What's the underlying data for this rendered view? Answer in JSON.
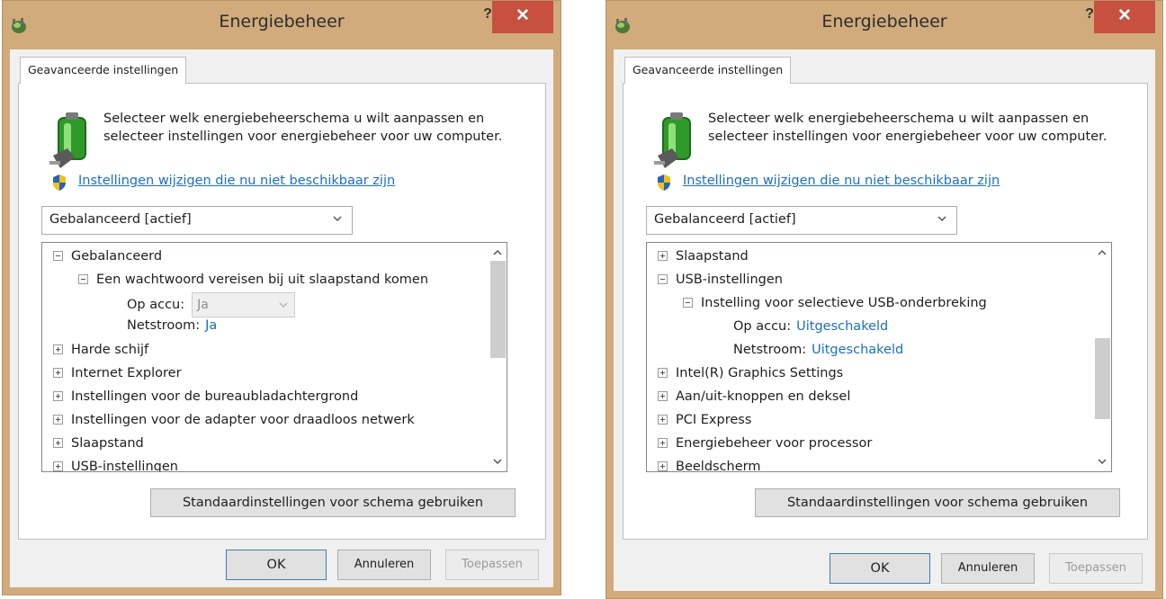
{
  "colors": {
    "frame": "#d1ab7c",
    "close_button": "#c7503f",
    "link": "#1c6ec8",
    "client": "#f0f0f0"
  },
  "dialogs": [
    {
      "title": "Energiebeheer",
      "help_label": "?",
      "close_label": "✕",
      "tab_label": "Geavanceerde instellingen",
      "description": "Selecteer welk energiebeheerschema u wilt aanpassen en selecteer instellingen voor energiebeheer voor uw computer.",
      "settings_link": "Instellingen wijzigen die nu niet beschikbaar zijn",
      "scheme_combo_value": "Gebalanceerd [actief]",
      "tree": {
        "items": [
          {
            "label": "Gebalanceerd",
            "expanded": true
          },
          {
            "label": "Een wachtwoord vereisen bij uit slaapstand komen",
            "expanded": true
          },
          {
            "label": "Op accu:",
            "value": "Ja",
            "value_kind": "disabled-combo"
          },
          {
            "label": "Netstroom:",
            "value": "Ja",
            "value_kind": "link"
          },
          {
            "label": "Harde schijf",
            "expanded": false
          },
          {
            "label": "Internet Explorer",
            "expanded": false
          },
          {
            "label": "Instellingen voor de bureaubladachtergrond",
            "expanded": false
          },
          {
            "label": "Instellingen voor de adapter voor draadloos netwerk",
            "expanded": false
          },
          {
            "label": "Slaapstand",
            "expanded": false
          },
          {
            "label": "USB-instellingen",
            "expanded": false
          }
        ],
        "scroll_position": 0.05,
        "scroll_visible_fraction": 0.54
      },
      "restore_defaults_label": "Standaardinstellingen voor schema gebruiken",
      "ok_label": "OK",
      "cancel_label": "Annuleren",
      "apply_label": "Toepassen"
    },
    {
      "title": "Energiebeheer",
      "help_label": "?",
      "close_label": "✕",
      "tab_label": "Geavanceerde instellingen",
      "description": "Selecteer welk energiebeheerschema u wilt aanpassen en selecteer instellingen voor energiebeheer voor uw computer.",
      "settings_link": "Instellingen wijzigen die nu niet beschikbaar zijn",
      "scheme_combo_value": "Gebalanceerd [actief]",
      "tree": {
        "items": [
          {
            "label": "Slaapstand",
            "expanded": false
          },
          {
            "label": "USB-instellingen",
            "expanded": true
          },
          {
            "label": "Instelling voor selectieve USB-onderbreking",
            "expanded": true
          },
          {
            "label": "Op accu:",
            "value": "Uitgeschakeld",
            "value_kind": "link"
          },
          {
            "label": "Netstroom:",
            "value": "Uitgeschakeld",
            "value_kind": "link"
          },
          {
            "label": "Intel(R) Graphics Settings",
            "expanded": false
          },
          {
            "label": "Aan/uit-knoppen en deksel",
            "expanded": false
          },
          {
            "label": "PCI Express",
            "expanded": false
          },
          {
            "label": "Energiebeheer voor processor",
            "expanded": false
          },
          {
            "label": "Beeldscherm",
            "expanded": false
          }
        ],
        "scroll_position": 0.46,
        "scroll_visible_fraction": 0.38
      },
      "restore_defaults_label": "Standaardinstellingen voor schema gebruiken",
      "ok_label": "OK",
      "cancel_label": "Annuleren",
      "apply_label": "Toepassen"
    }
  ]
}
